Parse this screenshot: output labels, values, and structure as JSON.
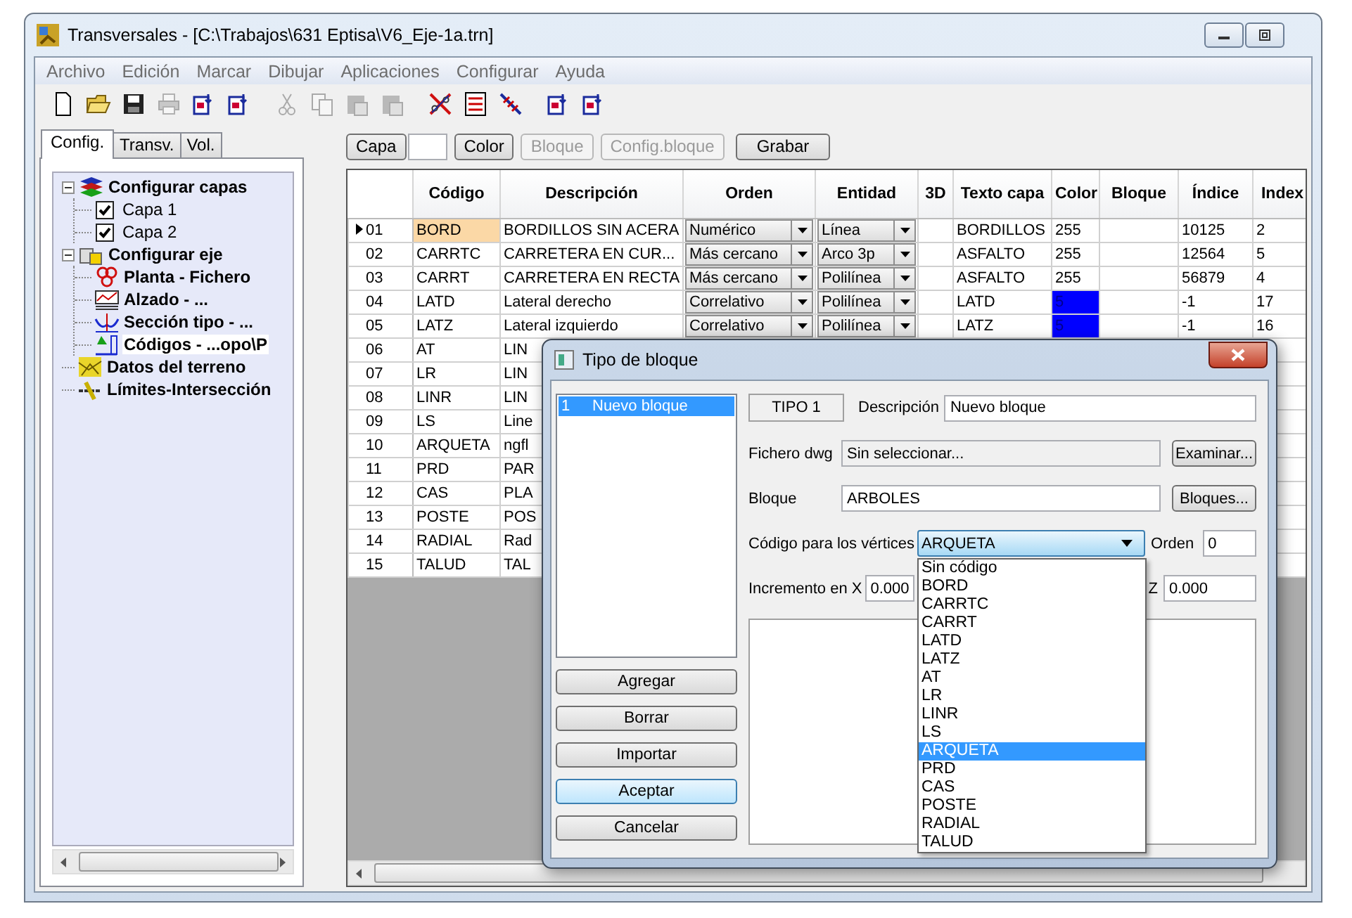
{
  "window": {
    "title": "Transversales - [C:\\Trabajos\\631 Eptisa\\V6_Eje-1a.trn]"
  },
  "menu": [
    "Archivo",
    "Edición",
    "Marcar",
    "Dibujar",
    "Aplicaciones",
    "Configurar",
    "Ayuda"
  ],
  "toolbar": [
    {
      "disabled": false
    },
    {
      "disabled": false
    },
    {
      "disabled": false
    },
    {
      "disabled": true
    },
    {
      "disabled": false
    },
    {
      "disabled": false
    },
    {
      "disabled": true
    },
    {
      "disabled": true
    },
    {
      "disabled": true
    },
    {
      "disabled": true
    },
    {
      "disabled": false
    },
    {
      "disabled": false
    },
    {
      "disabled": false
    },
    {
      "disabled": false
    },
    {
      "disabled": false
    }
  ],
  "left_tabs": [
    {
      "label": "Config.",
      "selected": true
    },
    {
      "label": "Transv.",
      "selected": false
    },
    {
      "label": "Vol.",
      "selected": false
    }
  ],
  "tree": [
    {
      "label": "Configurar capas",
      "kind": "group",
      "expanded": true,
      "selected": false,
      "children": [
        {
          "label": "Capa 1",
          "kind": "check",
          "checked": true,
          "selected": false
        },
        {
          "label": "Capa 2",
          "kind": "check",
          "checked": true,
          "selected": false
        }
      ]
    },
    {
      "label": "Configurar eje",
      "kind": "group",
      "expanded": true,
      "selected": false,
      "children": [
        {
          "label": "Planta - Fichero",
          "kind": "item",
          "selected": false
        },
        {
          "label": "Alzado - ...",
          "kind": "item",
          "selected": false
        },
        {
          "label": "Sección tipo - ...",
          "kind": "item",
          "selected": false
        },
        {
          "label": "Códigos - ...opo\\P",
          "kind": "item",
          "selected": true
        }
      ]
    },
    {
      "label": "Datos del terreno",
      "kind": "item",
      "selected": false
    },
    {
      "label": "Límites-Intersección",
      "kind": "item",
      "selected": false
    }
  ],
  "grid_toolbar": [
    {
      "kind": "button",
      "label": "Capa",
      "disabled": false
    },
    {
      "kind": "field"
    },
    {
      "kind": "button",
      "label": "Color",
      "disabled": false
    },
    {
      "kind": "button",
      "label": "Bloque",
      "disabled": true
    },
    {
      "kind": "button",
      "label": "Config.bloque",
      "disabled": true
    },
    {
      "kind": "button",
      "label": "Grabar",
      "disabled": false
    }
  ],
  "table": {
    "columns": [
      "Código",
      "Descripción",
      "Orden",
      "Entidad",
      "3D",
      "Texto capa",
      "Color",
      "Bloque",
      "Índice",
      "Index"
    ],
    "rows": [
      {
        "num": "01",
        "selected": true,
        "codigo": "BORD",
        "descripcion": "BORDILLOS SIN ACERA",
        "orden": "Numérico",
        "entidad": "Línea",
        "texto_capa": "BORDILLOS",
        "color_text": "255",
        "indice": "10125",
        "index": "2"
      },
      {
        "num": "02",
        "selected": false,
        "codigo": "CARRTC",
        "descripcion": "CARRETERA EN CUR...",
        "orden": "Más cercano",
        "entidad": "Arco 3p",
        "texto_capa": "ASFALTO",
        "color_text": "255",
        "indice": "12564",
        "index": "5"
      },
      {
        "num": "03",
        "selected": false,
        "codigo": "CARRT",
        "descripcion": "CARRETERA EN RECTA",
        "orden": "Más cercano",
        "entidad": "Polilínea",
        "texto_capa": "ASFALTO",
        "color_text": "255",
        "indice": "56879",
        "index": "4"
      },
      {
        "num": "04",
        "selected": false,
        "codigo": "LATD",
        "descripcion": "Lateral derecho",
        "orden": "Correlativo",
        "entidad": "Polilínea",
        "texto_capa": "LATD",
        "color_text": "5",
        "color": "#0000ff",
        "indice": "-1",
        "index": "17"
      },
      {
        "num": "05",
        "selected": false,
        "codigo": "LATZ",
        "descripcion": "Lateral izquierdo",
        "orden": "Correlativo",
        "entidad": "Polilínea",
        "texto_capa": "LATZ",
        "color_text": "5",
        "color": "#0000ff",
        "indice": "-1",
        "index": "16"
      },
      {
        "num": "06",
        "selected": false,
        "codigo": "AT",
        "descripcion": "LIN"
      },
      {
        "num": "07",
        "selected": false,
        "codigo": "LR",
        "descripcion": "LIN"
      },
      {
        "num": "08",
        "selected": false,
        "codigo": "LINR",
        "descripcion": "LIN"
      },
      {
        "num": "09",
        "selected": false,
        "codigo": "LS",
        "descripcion": "Line"
      },
      {
        "num": "10",
        "selected": false,
        "codigo": "ARQUETA",
        "descripcion": "ngfl"
      },
      {
        "num": "11",
        "selected": false,
        "codigo": "PRD",
        "descripcion": "PAR"
      },
      {
        "num": "12",
        "selected": false,
        "codigo": "CAS",
        "descripcion": "PLA"
      },
      {
        "num": "13",
        "selected": false,
        "codigo": "POSTE",
        "descripcion": "POS"
      },
      {
        "num": "14",
        "selected": false,
        "codigo": "RADIAL",
        "descripcion": "Rad"
      },
      {
        "num": "15",
        "selected": false,
        "codigo": "TALUD",
        "descripcion": "TAL"
      }
    ]
  },
  "dialog": {
    "title": "Tipo de bloque",
    "list": [
      {
        "number": "1",
        "label": "Nuevo bloque",
        "selected": true
      }
    ],
    "buttons": [
      {
        "label": "Agregar",
        "default": false
      },
      {
        "label": "Borrar",
        "default": false
      },
      {
        "label": "Importar",
        "default": false
      },
      {
        "label": "Aceptar",
        "default": true
      },
      {
        "label": "Cancelar",
        "default": false
      }
    ],
    "tipo": "TIPO 1",
    "descripcion": {
      "label": "Descripción",
      "value": "Nuevo bloque"
    },
    "fichero": {
      "label": "Fichero dwg",
      "value": "Sin seleccionar...",
      "button": "Examinar..."
    },
    "bloque": {
      "label": "Bloque",
      "value": "ARBOLES",
      "button": "Bloques..."
    },
    "codigo": {
      "label": "Código para los vértices",
      "value": "ARQUETA",
      "expanded": true,
      "options": [
        {
          "label": "Sin código",
          "selected": false
        },
        {
          "label": "BORD",
          "selected": false
        },
        {
          "label": "CARRTC",
          "selected": false
        },
        {
          "label": "CARRT",
          "selected": false
        },
        {
          "label": "LATD",
          "selected": false
        },
        {
          "label": "LATZ",
          "selected": false
        },
        {
          "label": "AT",
          "selected": false
        },
        {
          "label": "LR",
          "selected": false
        },
        {
          "label": "LINR",
          "selected": false
        },
        {
          "label": "LS",
          "selected": false
        },
        {
          "label": "ARQUETA",
          "selected": true
        },
        {
          "label": "PRD",
          "selected": false
        },
        {
          "label": "CAS",
          "selected": false
        },
        {
          "label": "POSTE",
          "selected": false
        },
        {
          "label": "RADIAL",
          "selected": false
        },
        {
          "label": "TALUD",
          "selected": false
        }
      ]
    },
    "orden": {
      "label": "Orden",
      "value": "0"
    },
    "incremento_x": {
      "label": "Incremento en X",
      "value": "0.000"
    },
    "incremento_z": {
      "label": "Z",
      "value": "0.000"
    }
  }
}
